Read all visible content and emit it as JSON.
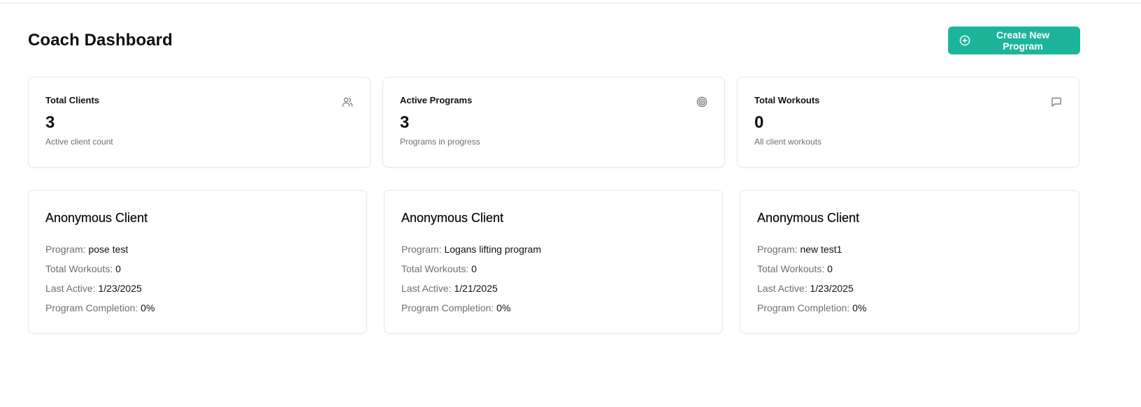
{
  "header": {
    "title": "Coach Dashboard",
    "create_button": {
      "label": "Create New Program",
      "icon": "plus-circle-icon",
      "color": "#1cb59b"
    }
  },
  "stats": [
    {
      "label": "Total Clients",
      "value": "3",
      "sub": "Active client count",
      "icon": "users-icon"
    },
    {
      "label": "Active Programs",
      "value": "3",
      "sub": "Programs in progress",
      "icon": "target-icon"
    },
    {
      "label": "Total Workouts",
      "value": "0",
      "sub": "All client workouts",
      "icon": "message-square-icon"
    }
  ],
  "field_labels": {
    "program": "Program:",
    "total_workouts": "Total Workouts:",
    "last_active": "Last Active:",
    "completion": "Program Completion:"
  },
  "clients": [
    {
      "name": "Anonymous Client",
      "program": "pose test",
      "total_workouts": "0",
      "last_active": "1/23/2025",
      "completion": "0%"
    },
    {
      "name": "Anonymous Client",
      "program": "Logans lifting program",
      "total_workouts": "0",
      "last_active": "1/21/2025",
      "completion": "0%"
    },
    {
      "name": "Anonymous Client",
      "program": "new test1",
      "total_workouts": "0",
      "last_active": "1/23/2025",
      "completion": "0%"
    }
  ]
}
